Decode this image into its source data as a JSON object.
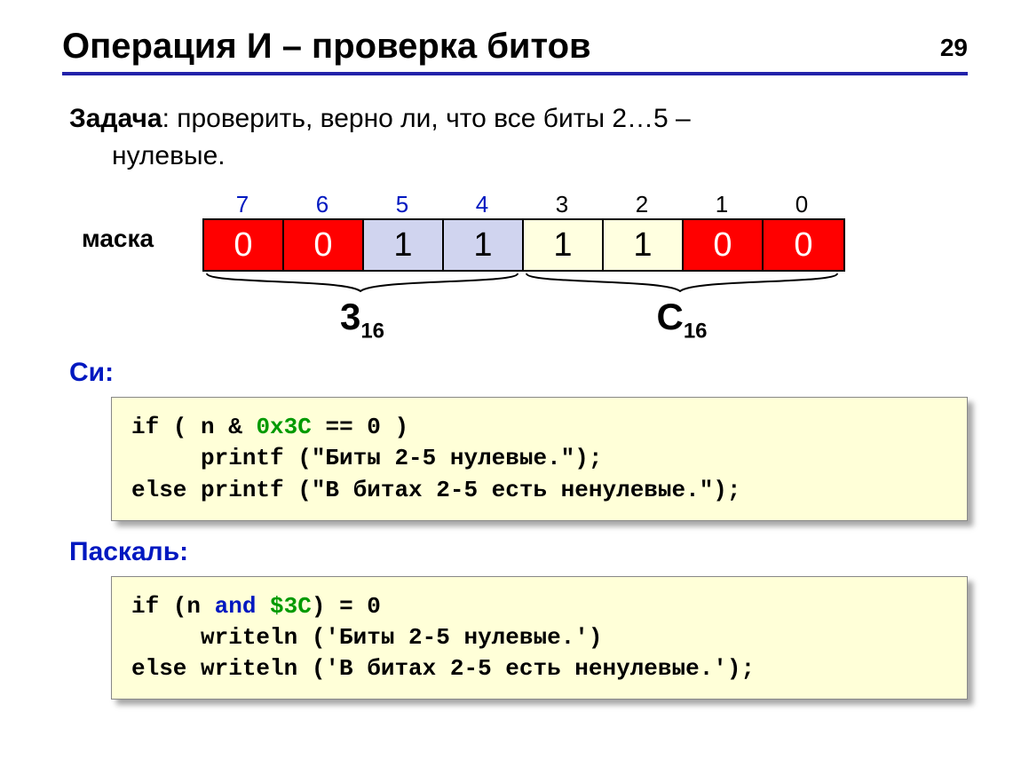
{
  "page_number": "29",
  "title": "Операция И – проверка битов",
  "task": {
    "label": "Задача",
    "line1_rest": ": проверить, верно ли, что все биты 2…5 –",
    "line2": "нулевые."
  },
  "mask_label": "маска",
  "bit_indices": [
    "7",
    "6",
    "5",
    "4",
    "3",
    "2",
    "1",
    "0"
  ],
  "bit_values": [
    "0",
    "0",
    "1",
    "1",
    "1",
    "1",
    "0",
    "0"
  ],
  "bit_colors": [
    "red",
    "red",
    "blue",
    "blue",
    "yellow",
    "yellow",
    "red",
    "red"
  ],
  "hex_left": {
    "digit": "3",
    "base": "16"
  },
  "hex_right": {
    "digit": "C",
    "base": "16"
  },
  "c_label": "Си:",
  "c_code": {
    "l1a": "if ( n & ",
    "l1b": "0x3C",
    "l1c": " == 0 )",
    "l2": "     printf (\"Биты 2-5 нулевые.\");",
    "l3": "else printf (\"В битах 2-5 есть ненулевые.\");"
  },
  "pascal_label": "Паскаль:",
  "pascal_code": {
    "l1a": "if (n ",
    "l1b": "and",
    "l1c": " ",
    "l1d": "$3C",
    "l1e": ") = 0",
    "l2": "     writeln ('Биты 2-5 нулевые.')",
    "l3": "else writeln ('В битах 2-5 есть ненулевые.');"
  }
}
